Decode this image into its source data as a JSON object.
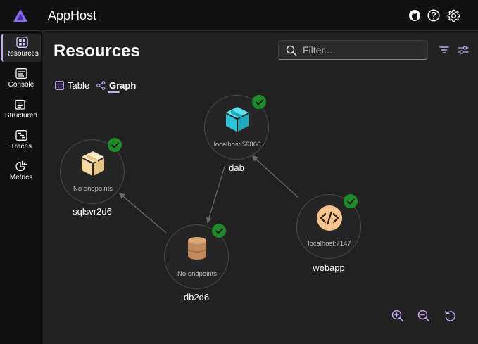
{
  "app": {
    "title": "AppHost"
  },
  "header_icons": [
    "github-icon",
    "help-icon",
    "settings-icon"
  ],
  "nav": [
    {
      "label": "Resources",
      "icon": "resources-icon",
      "active": true
    },
    {
      "label": "Console",
      "icon": "console-icon",
      "active": false
    },
    {
      "label": "Structured",
      "icon": "structured-logs-icon",
      "active": false
    },
    {
      "label": "Traces",
      "icon": "traces-icon",
      "active": false
    },
    {
      "label": "Metrics",
      "icon": "metrics-icon",
      "active": false
    }
  ],
  "page": {
    "title": "Resources"
  },
  "filter": {
    "placeholder": "Filter..."
  },
  "tabs": [
    {
      "label": "Table",
      "icon": "table-icon",
      "active": false
    },
    {
      "label": "Graph",
      "icon": "graph-icon",
      "active": true
    }
  ],
  "graph": {
    "nodes": [
      {
        "name": "dab",
        "endpoint": "localhost:59866",
        "icon": "container-icon",
        "color": "#2ec4d6",
        "status": "running"
      },
      {
        "name": "sqlsvr2d6",
        "endpoint": "No endpoints",
        "icon": "box-icon",
        "color": "#f5d7a1",
        "status": "running"
      },
      {
        "name": "db2d6",
        "endpoint": "No endpoints",
        "icon": "database-icon",
        "color": "#c08a5c",
        "status": "running"
      },
      {
        "name": "webapp",
        "endpoint": "localhost:7147",
        "icon": "code-icon",
        "color": "#f8c38f",
        "status": "running"
      }
    ],
    "edges": [
      {
        "from": "dab",
        "to": "db2d6"
      },
      {
        "from": "db2d6",
        "to": "sqlsvr2d6"
      },
      {
        "from": "webapp",
        "to": "dab"
      }
    ]
  },
  "zoom_controls": [
    "zoom-in-icon",
    "zoom-out-icon",
    "reset-view-icon"
  ],
  "colors": {
    "accent": "#c6a8f7",
    "status_running": "#1f8a2a",
    "background": "#212121"
  }
}
